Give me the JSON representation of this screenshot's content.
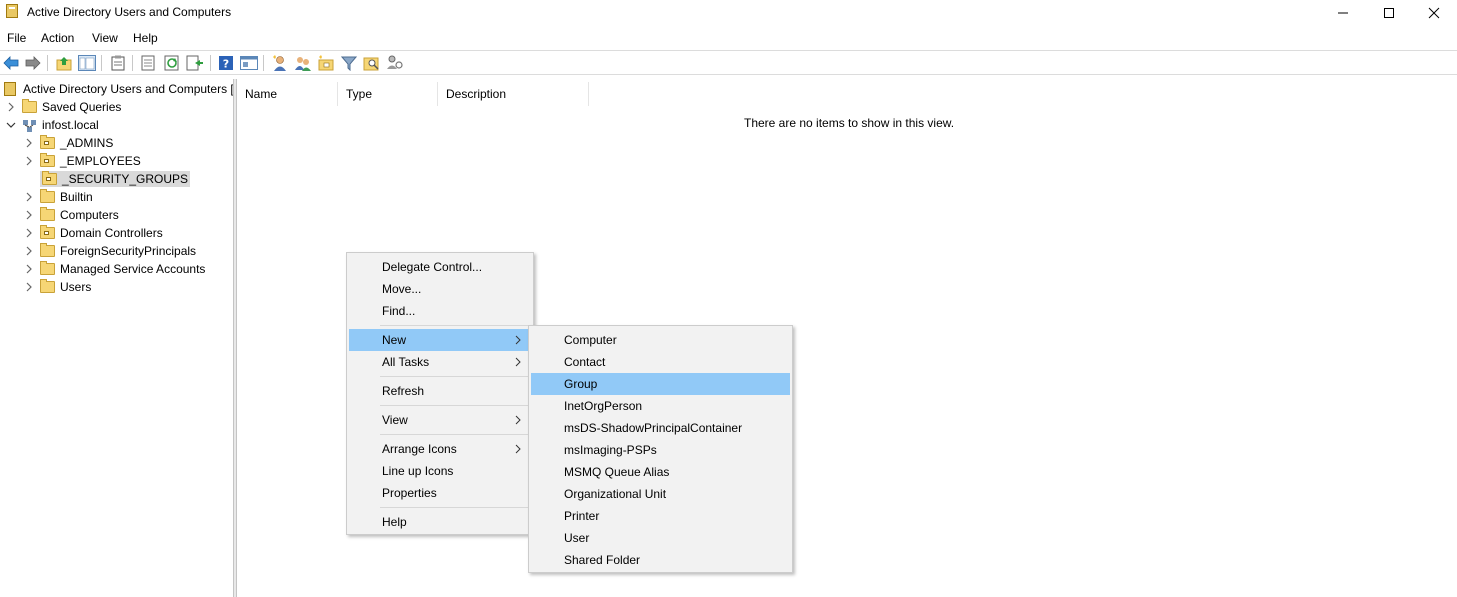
{
  "window": {
    "title": "Active Directory Users and Computers",
    "controls": [
      "minimize",
      "maximize",
      "close"
    ]
  },
  "menubar": [
    "File",
    "Action",
    "View",
    "Help"
  ],
  "toolbar": {
    "icons": [
      "back-icon",
      "forward-icon",
      "up-folder-icon",
      "show-hide-tree-icon",
      "clipboard-icon",
      "properties-icon",
      "refresh-icon",
      "export-list-icon",
      "help-icon",
      "console-view-icon",
      "new-user-icon",
      "new-group-icon",
      "new-ou-icon",
      "filter-icon",
      "find-icon",
      "delegate-icon"
    ]
  },
  "tree": {
    "root": "Active Directory Users and Computers [i",
    "saved_queries": "Saved Queries",
    "domain": "infost.local",
    "children": [
      "_ADMINS",
      "_EMPLOYEES",
      "_SECURITY_GROUPS",
      "Builtin",
      "Computers",
      "Domain Controllers",
      "ForeignSecurityPrincipals",
      "Managed Service Accounts",
      "Users"
    ],
    "selected": "_SECURITY_GROUPS"
  },
  "list": {
    "columns": [
      "Name",
      "Type",
      "Description"
    ],
    "empty_message": "There are no items to show in this view."
  },
  "context_menu": {
    "items": [
      "Delegate Control...",
      "Move...",
      "Find...",
      "New",
      "All Tasks",
      "Refresh",
      "View",
      "Arrange Icons",
      "Line up Icons",
      "Properties",
      "Help"
    ],
    "highlighted": "New"
  },
  "submenu_new": {
    "items": [
      "Computer",
      "Contact",
      "Group",
      "InetOrgPerson",
      "msDS-ShadowPrincipalContainer",
      "msImaging-PSPs",
      "MSMQ Queue Alias",
      "Organizational Unit",
      "Printer",
      "User",
      "Shared Folder"
    ],
    "highlighted": "Group"
  },
  "colors": {
    "highlight": "#91c9f7",
    "menu_bg": "#f2f2f2",
    "folder": "#f6d675",
    "selection": "#d9d9d9"
  }
}
